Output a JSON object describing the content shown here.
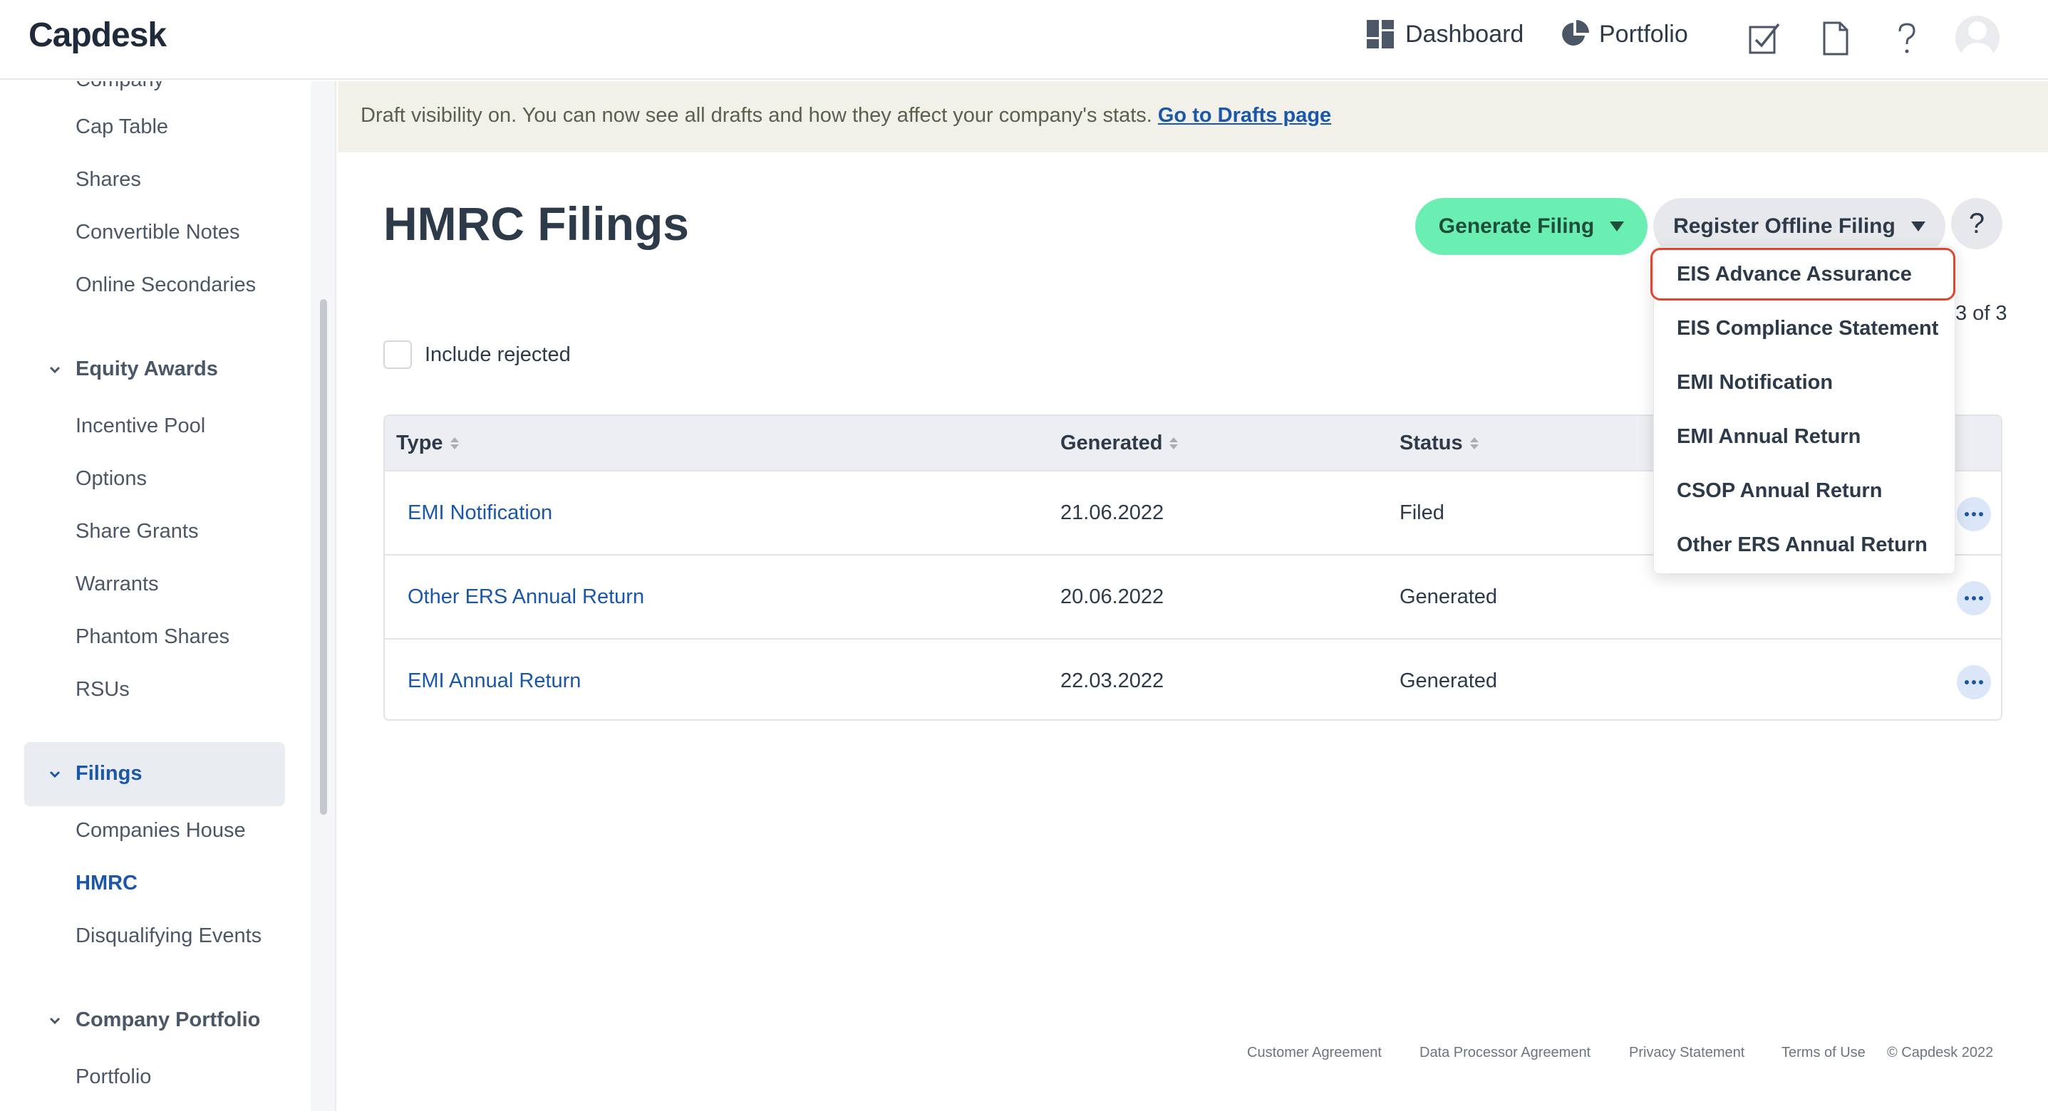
{
  "app": {
    "logo": "Capdesk"
  },
  "topnav": {
    "dashboard": "Dashboard",
    "portfolio": "Portfolio"
  },
  "topicons": [
    "tasks-check-icon",
    "document-icon",
    "help-icon",
    "user-avatar-icon"
  ],
  "sidebar": {
    "cutoff_item": "Company",
    "items": {
      "cap_table": "Cap Table",
      "shares": "Shares",
      "convertible_notes": "Convertible Notes",
      "online_secondaries": "Online Secondaries",
      "equity_awards": "Equity Awards",
      "incentive_pool": "Incentive Pool",
      "options": "Options",
      "share_grants": "Share Grants",
      "warrants": "Warrants",
      "phantom_shares": "Phantom Shares",
      "rsus": "RSUs",
      "filings": "Filings",
      "companies_house": "Companies House",
      "hmrc": "HMRC",
      "disqualifying_events": "Disqualifying Events",
      "company_portfolio": "Company Portfolio",
      "portfolio": "Portfolio"
    }
  },
  "banner": {
    "text": "Draft visibility on. You can now see all drafts and how they affect your company's stats. ",
    "link": "Go to Drafts page"
  },
  "page": {
    "title": "HMRC Filings",
    "generate_button": "Generate Filing",
    "register_button": "Register Offline Filing",
    "help_button": "?",
    "page_count": "3 of 3",
    "include_rejected": "Include rejected"
  },
  "table": {
    "headers": {
      "type": "Type",
      "generated": "Generated",
      "status": "Status"
    },
    "rows": [
      {
        "type": "EMI Notification",
        "generated": "21.06.2022",
        "status": "Filed"
      },
      {
        "type": "Other ERS Annual Return",
        "generated": "20.06.2022",
        "status": "Generated"
      },
      {
        "type": "EMI Annual Return",
        "generated": "22.03.2022",
        "status": "Generated"
      }
    ]
  },
  "dropdown": {
    "items": [
      "EIS Advance Assurance",
      "EIS Compliance Statement",
      "EMI Notification",
      "EMI Annual Return",
      "CSOP Annual Return",
      "Other ERS Annual Return"
    ],
    "highlight_color": "#e0452f"
  },
  "footer": {
    "customer_agreement": "Customer Agreement",
    "data_processor_agreement": "Data Processor Agreement",
    "privacy_statement": "Privacy Statement",
    "terms_of_use": "Terms of Use",
    "copyright": "© Capdesk 2022"
  },
  "colors": {
    "accent": "#1b57a8",
    "generate": "#6aeeb2",
    "banner": "#f1f1e9"
  }
}
